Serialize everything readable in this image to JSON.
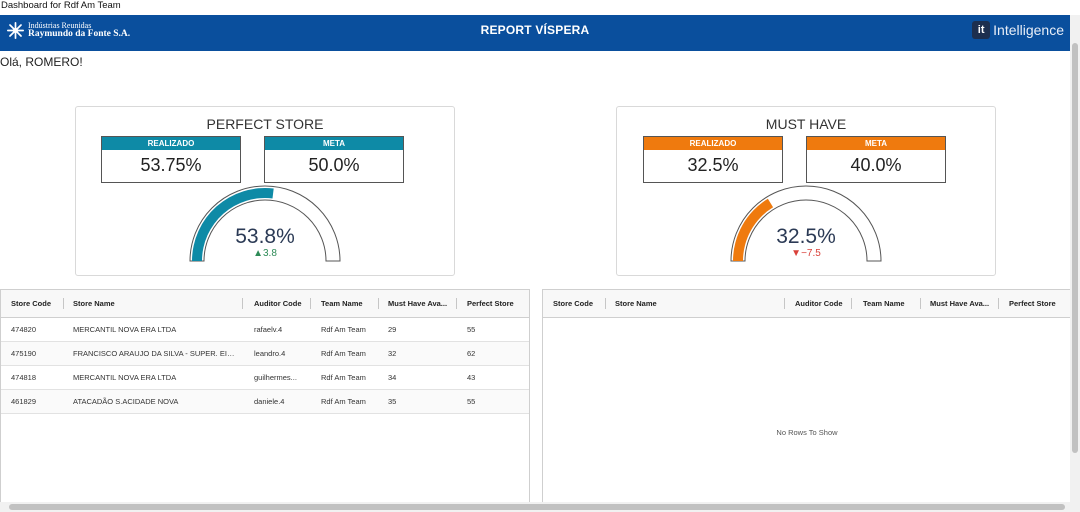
{
  "window": {
    "title": "Dashboard for Rdf Am Team"
  },
  "header": {
    "logo_line1": "Indústrias Reunidas",
    "logo_line2": "Raymundo da Fonte S.A.",
    "title": "REPORT VÍSPERA",
    "brand_mark": "it",
    "brand_text": "Intelligence",
    "color": "#0a4f9d"
  },
  "greeting": "Olá, ROMERO!",
  "cards": [
    {
      "title": "PERFECT STORE",
      "realizado_label": "REALIZADO",
      "realizado_value": "53.75%",
      "meta_label": "META",
      "meta_value": "50.0%",
      "gauge_value": "53.8%",
      "gauge_fraction": 0.538,
      "delta": "▲3.8",
      "accent": "#0e8aa6",
      "delta_color": "#2e8b57"
    },
    {
      "title": "MUST HAVE",
      "realizado_label": "REALIZADO",
      "realizado_value": "32.5%",
      "meta_label": "META",
      "meta_value": "40.0%",
      "gauge_value": "32.5%",
      "gauge_fraction": 0.325,
      "delta": "▼−7.5",
      "accent": "#ef7a0e",
      "delta_color": "#d9413a"
    }
  ],
  "grids": [
    {
      "columns": [
        "Store Code",
        "Store Name",
        "Auditor Code",
        "Team Name",
        "Must Have Ava...",
        "Perfect Store"
      ],
      "rows": [
        [
          "474820",
          "MERCANTIL NOVA ERA LTDA",
          "rafaelv.4",
          "Rdf Am Team",
          "29",
          "55"
        ],
        [
          "475190",
          "FRANCISCO ARAUJO DA SILVA - SUPER. EIR...",
          "leandro.4",
          "Rdf Am Team",
          "32",
          "62"
        ],
        [
          "474818",
          "MERCANTIL NOVA ERA LTDA",
          "guilhermes...",
          "Rdf Am Team",
          "34",
          "43"
        ],
        [
          "461829",
          "ATACADÃO S.ACIDADE NOVA",
          "daniele.4",
          "Rdf Am Team",
          "35",
          "55"
        ]
      ],
      "empty_text": ""
    },
    {
      "columns": [
        "Store Code",
        "Store Name",
        "Auditor Code",
        "Team Name",
        "Must Have Ava...",
        "Perfect Store"
      ],
      "rows": [],
      "empty_text": "No Rows To Show"
    }
  ]
}
